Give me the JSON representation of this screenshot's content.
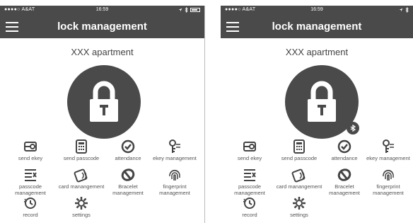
{
  "screens": [
    {
      "status": {
        "carrier": "●●●●○ A&AT",
        "time": "16:59"
      },
      "nav": {
        "title": "lock management"
      },
      "apartment": "XXX apartment",
      "items": [
        {
          "label": "send ekey",
          "icon": "send-ekey-icon"
        },
        {
          "label": "send passcode",
          "icon": "keypad-icon"
        },
        {
          "label": "attendance",
          "icon": "checkmark-icon"
        },
        {
          "label": "ekey management",
          "icon": "ekey-management-icon"
        },
        {
          "label": "passcode management",
          "icon": "passcode-list-icon"
        },
        {
          "label": "card manangement",
          "icon": "card-icon"
        },
        {
          "label": "Bracelet management",
          "icon": "bracelet-icon"
        },
        {
          "label": "fingerprint management",
          "icon": "fingerprint-icon"
        },
        {
          "label": "record",
          "icon": "clock-icon"
        },
        {
          "label": "settings",
          "icon": "gear-icon"
        }
      ]
    },
    {
      "status": {
        "carrier": "●●●●○ A&AT",
        "time": "16:59"
      },
      "nav": {
        "title": "lock management"
      },
      "apartment": "XXX apartment",
      "items": [
        {
          "label": "send ekey",
          "icon": "send-ekey-icon"
        },
        {
          "label": "send passcode",
          "icon": "keypad-icon"
        },
        {
          "label": "attendance",
          "icon": "checkmark-icon"
        },
        {
          "label": "ekey management",
          "icon": "ekey-management-icon"
        },
        {
          "label": "passcode management",
          "icon": "passcode-list-icon"
        },
        {
          "label": "card manangement",
          "icon": "card-icon"
        },
        {
          "label": "Bracelet management",
          "icon": "bracelet-icon"
        },
        {
          "label": "fingerprint management",
          "icon": "fingerprint-icon"
        },
        {
          "label": "record",
          "icon": "clock-icon"
        },
        {
          "label": "settings",
          "icon": "gear-icon"
        }
      ]
    }
  ],
  "colors": {
    "bar": "#4a4a4a",
    "background": "#ffffff",
    "text": "#555555"
  }
}
